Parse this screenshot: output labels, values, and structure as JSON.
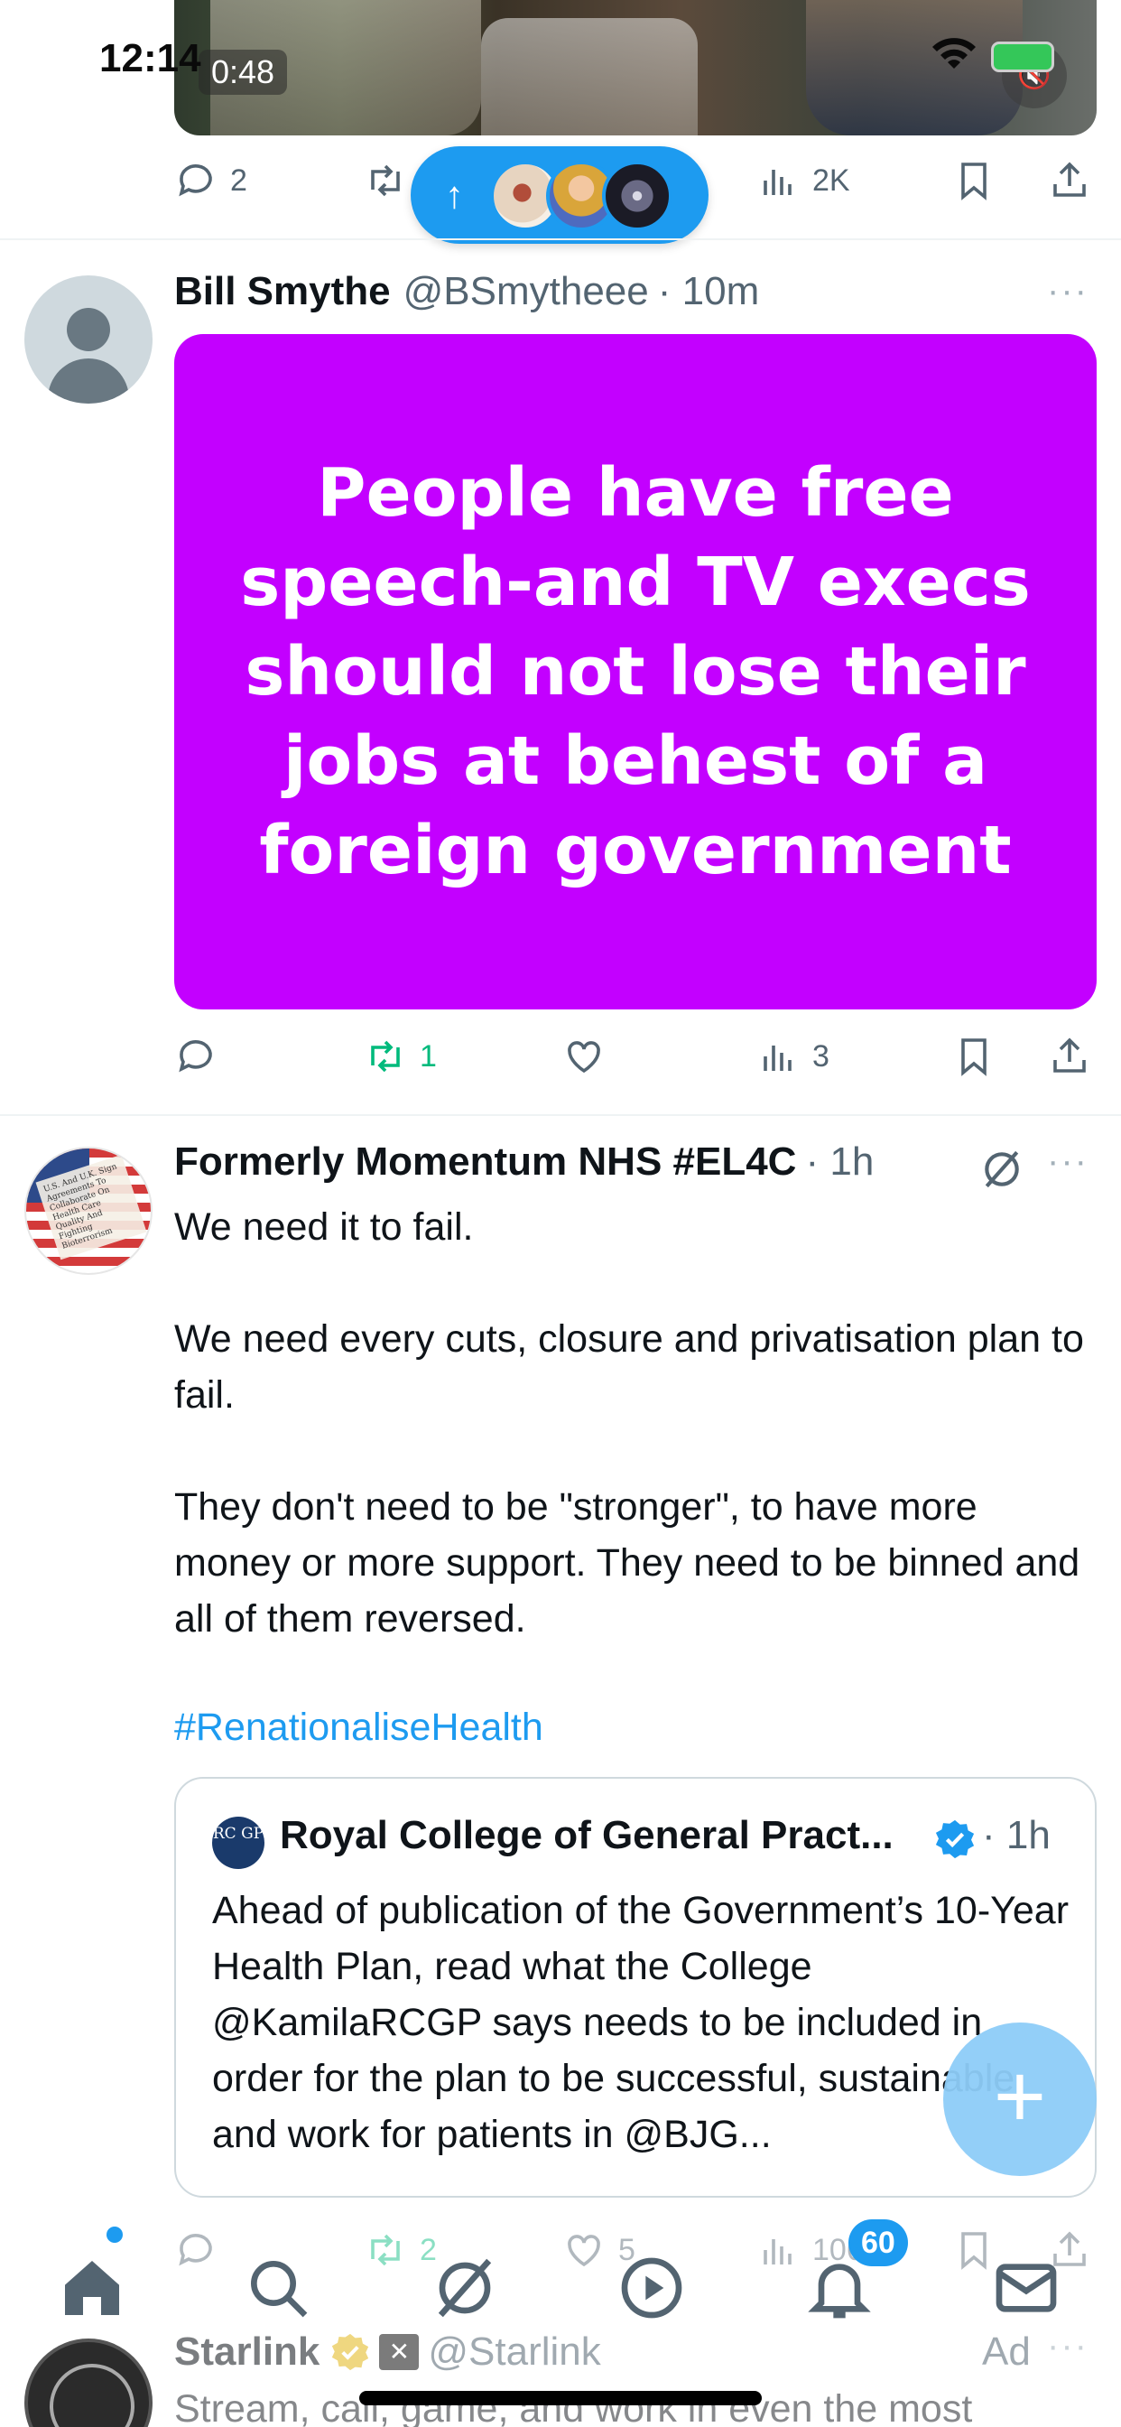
{
  "status_bar": {
    "time": "12:14"
  },
  "media": {
    "video_time": "0:48"
  },
  "tweet0": {
    "replies": "2",
    "views": "2K"
  },
  "tweet1": {
    "name": "Bill Smythe",
    "handle": "@BSmytheee",
    "time": "· 10m",
    "image_text": "People have free speech-and TV execs should not lose their jobs at behest of a foreign government",
    "retweets": "1",
    "views": "3"
  },
  "tweet2": {
    "name": "Formerly Momentum NHS #EL4C",
    "time": "· 1h",
    "line1": "We need it to fail.",
    "line2": "We need every cuts, closure and privatisation plan to fail.",
    "line3": "They don't need to be \"stronger\", to have more money or more support. They need to be binned and all of them reversed.",
    "hashtag": "#RenationaliseHealth",
    "quote": {
      "logo_text": "RC GP",
      "name": "Royal College of General Pract...",
      "time": "· 1h",
      "body": "Ahead of publication of the Government’s 10-Year Health Plan, read what the College @KamilaRCGP says needs to be included in order for the plan to be successful, sustainable and work for patients in @BJG..."
    },
    "retweets": "2",
    "likes": "5",
    "views": "1060"
  },
  "tabbar": {
    "notifications_badge": "60"
  },
  "ad": {
    "name": "Starlink",
    "handle": "@Starlink",
    "label": "Ad",
    "text": "Stream, call, game, and work in even the most"
  },
  "colors": {
    "accent": "#1d9bf0",
    "card_purple": "#c300ff",
    "retweet_green": "#00ba7c",
    "muted": "#536471"
  },
  "icons": [
    "reply-icon",
    "retweet-icon",
    "like-icon",
    "views-icon",
    "bookmark-icon",
    "share-icon",
    "more-icon",
    "grok-icon",
    "verified-icon",
    "home-icon",
    "search-icon",
    "play-icon",
    "bell-icon",
    "mail-icon",
    "compose-icon"
  ]
}
